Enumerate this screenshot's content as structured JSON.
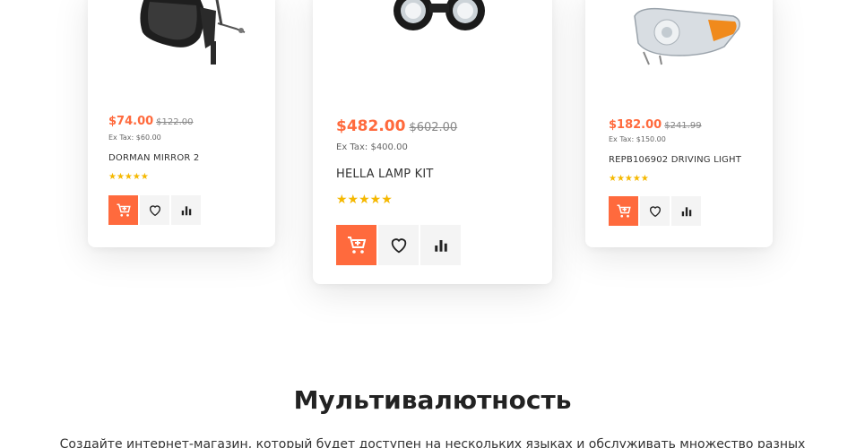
{
  "products": [
    {
      "name": "DORMAN MIRROR 2",
      "price_new": "$74.00",
      "price_old": "$122.00",
      "ex_tax": "Ex Tax: $60.00",
      "stars": "★★★★★",
      "image": "side-mirror"
    },
    {
      "name": "HELLA LAMP KIT",
      "price_new": "$482.00",
      "price_old": "$602.00",
      "ex_tax": "Ex Tax: $400.00",
      "stars": "★★★★★",
      "image": "fog-lamp-kit"
    },
    {
      "name": "REPB106902 DRIVING LIGHT",
      "price_new": "$182.00",
      "price_old": "$241.99",
      "ex_tax": "Ex Tax: $150.00",
      "stars": "★★★★★",
      "image": "headlight"
    }
  ],
  "rating": 5,
  "colors": {
    "accent": "#ff6a3d",
    "star": "#f5b800",
    "button_bg": "#f4f4f4"
  },
  "icons": [
    "add-to-cart-icon",
    "heart-icon",
    "compare-icon"
  ],
  "section": {
    "title": "Мультивалютность",
    "text": "Создайте интернет-магазин, который будет доступен на нескольких языках и обслуживать множество разных"
  }
}
